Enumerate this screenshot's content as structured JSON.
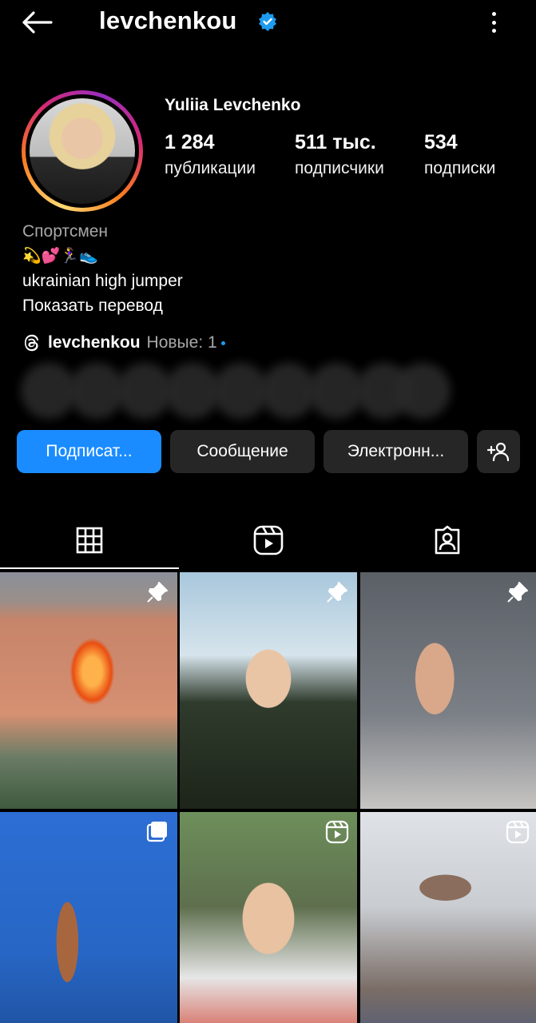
{
  "header": {
    "username": "levchenkou",
    "icons": {
      "back": "arrow-left-icon",
      "verified": "verified-badge-icon",
      "more": "more-vertical-icon"
    }
  },
  "profile": {
    "display_name": "Yuliia Levchenko",
    "stats": [
      {
        "value": "1 284",
        "label": "публикации"
      },
      {
        "value": "511 тыс.",
        "label": "подписчики"
      },
      {
        "value": "534",
        "label": "подписки"
      }
    ],
    "category": "Спортсмен",
    "emoji_line": "💫💕🏃‍♀️👟",
    "bio": "ukrainian high jumper",
    "translate_link": "Показать перевод",
    "threads": {
      "handle": "levchenkou",
      "new_label": "Новые: 1"
    }
  },
  "actions": {
    "follow": "Подписат...",
    "message": "Сообщение",
    "email": "Электронн...",
    "suggest_icon": "add-person-icon"
  },
  "tabs": [
    {
      "name": "grid",
      "icon": "grid-icon",
      "active": true
    },
    {
      "name": "reels",
      "icon": "reels-icon",
      "active": false
    },
    {
      "name": "tagged",
      "icon": "tagged-icon",
      "active": false
    }
  ],
  "posts": [
    {
      "badge": "pin-icon"
    },
    {
      "badge": "pin-icon"
    },
    {
      "badge": "pin-icon"
    },
    {
      "badge": "carousel-icon"
    },
    {
      "badge": "reel-icon"
    },
    {
      "badge": "reel-icon"
    }
  ],
  "colors": {
    "primary_button": "#1a8cff",
    "secondary_button": "#262626",
    "background": "#000000",
    "verified": "#1d9bf0"
  }
}
